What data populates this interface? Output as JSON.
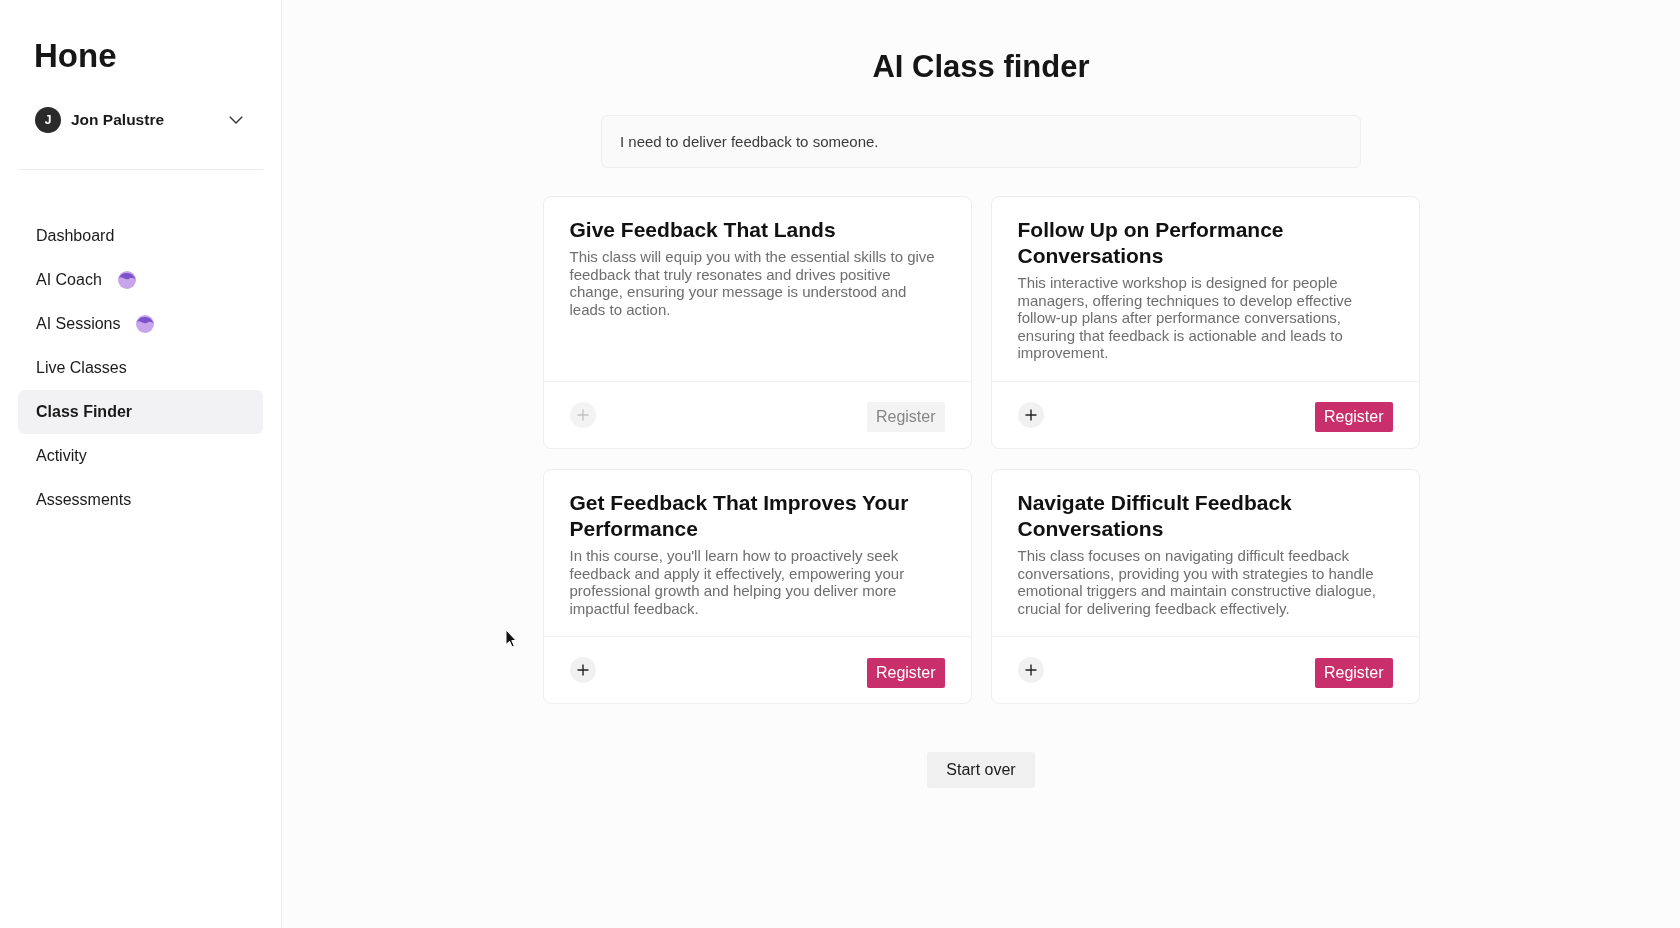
{
  "sidebar": {
    "logo": "Hone",
    "user": {
      "initial": "J",
      "name": "Jon Palustre"
    },
    "nav_items": [
      {
        "label": "Dashboard",
        "selected": false,
        "ai_badge": false
      },
      {
        "label": "AI Coach",
        "selected": false,
        "ai_badge": true
      },
      {
        "label": "AI Sessions",
        "selected": false,
        "ai_badge": true
      },
      {
        "label": "Live Classes",
        "selected": false,
        "ai_badge": false
      },
      {
        "label": "Class Finder",
        "selected": true,
        "ai_badge": false
      },
      {
        "label": "Activity",
        "selected": false,
        "ai_badge": false
      },
      {
        "label": "Assessments",
        "selected": false,
        "ai_badge": false
      }
    ]
  },
  "main": {
    "title": "AI Class finder",
    "query": {
      "value": "I need to deliver feedback to someone."
    },
    "classes": [
      {
        "title": "Give Feedback That Lands",
        "description": "This class will equip you with the essential skills to give feedback that truly resonates and drives positive change, ensuring your message is understood and leads to action.",
        "register_label": "Register",
        "disabled": true
      },
      {
        "title": "Follow Up on Performance Conversations",
        "description": "This interactive workshop is designed for people managers, offering techniques to develop effective follow-up plans after performance conversations, ensuring that feedback is actionable and leads to improvement.",
        "register_label": "Register",
        "disabled": false
      },
      {
        "title": "Get Feedback That Improves Your Performance",
        "description": "In this course, you'll learn how to proactively seek feedback and apply it effectively, empowering your professional growth and helping you deliver more impactful feedback.",
        "register_label": "Register",
        "disabled": false
      },
      {
        "title": "Navigate Difficult Feedback Conversations",
        "description": "This class focuses on navigating difficult feedback conversations, providing you with strategies to handle emotional triggers and maintain constructive dialogue, crucial for delivering feedback effectively.",
        "register_label": "Register",
        "disabled": false
      }
    ],
    "start_over": "Start over"
  }
}
